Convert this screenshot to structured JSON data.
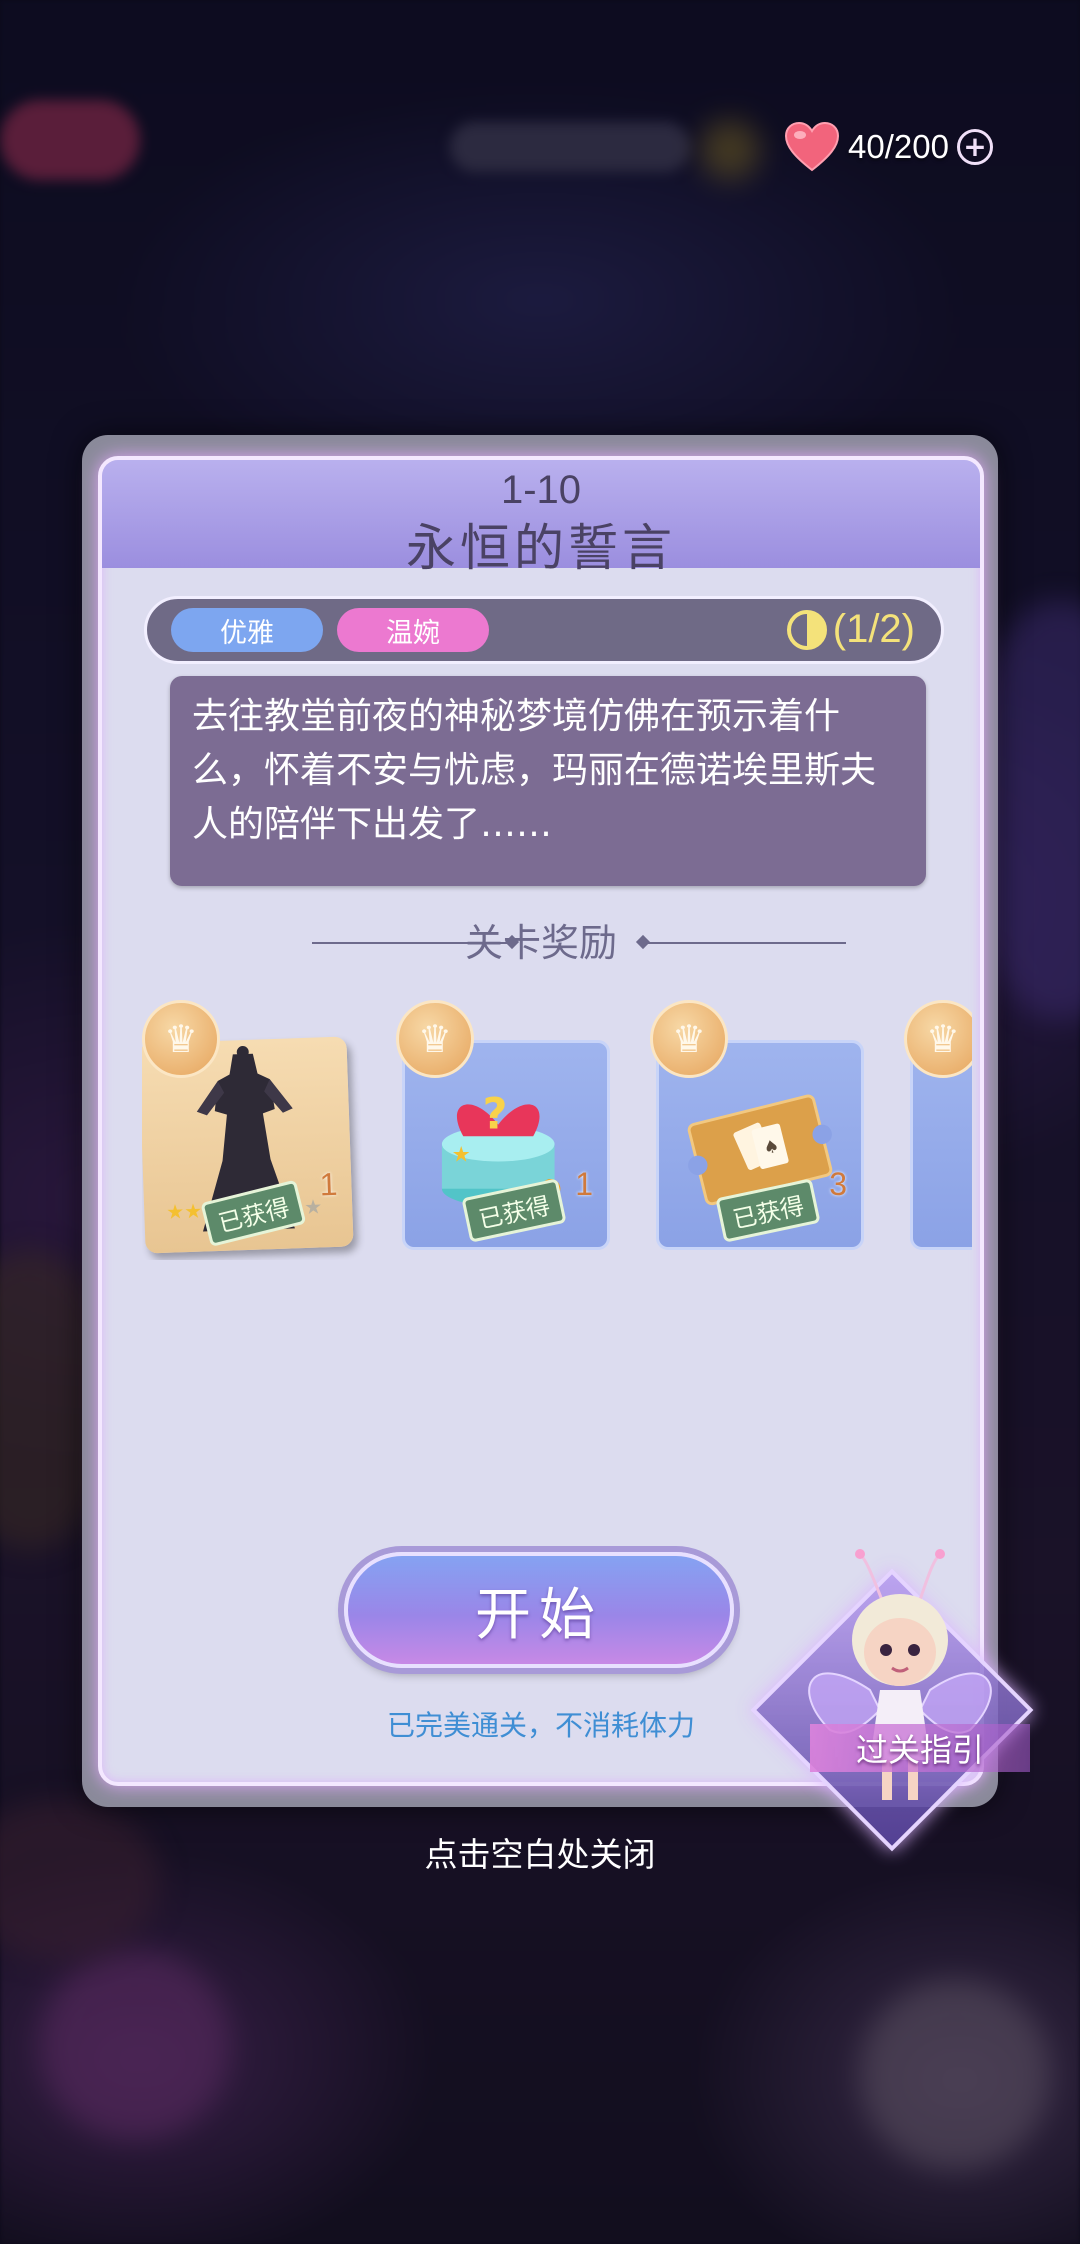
{
  "status": {
    "energy_current": "40",
    "energy_text": "40/200",
    "energy_add": "+"
  },
  "dialog": {
    "level_number": "1-10",
    "level_title": "永恒的誓言",
    "tags": [
      "优雅",
      "温婉"
    ],
    "progress_text": "(1/2)",
    "description": "去往教堂前夜的神秘梦境仿佛在预示着什么，怀着不安与忧虑，玛丽在德诺埃里斯夫人的陪伴下出发了……",
    "reward_section_title": "关卡奖励",
    "rewards": [
      {
        "type": "dress",
        "status": "已获得",
        "count": "1"
      },
      {
        "type": "mystery-gift",
        "status": "已获得",
        "count": "1"
      },
      {
        "type": "ticket",
        "status": "已获得",
        "count": "3"
      }
    ],
    "start_label": "开始",
    "perfect_note": "已完美通关，不消耗体力"
  },
  "guide": {
    "label": "过关指引"
  },
  "close_hint": "点击空白处关闭",
  "colors": {
    "accent_purple": "#9b8edf",
    "tag_blue": "#7da6f0",
    "tag_pink": "#ec79d0",
    "progress_yellow": "#f4e27a",
    "note_blue": "#3f8ed4"
  }
}
